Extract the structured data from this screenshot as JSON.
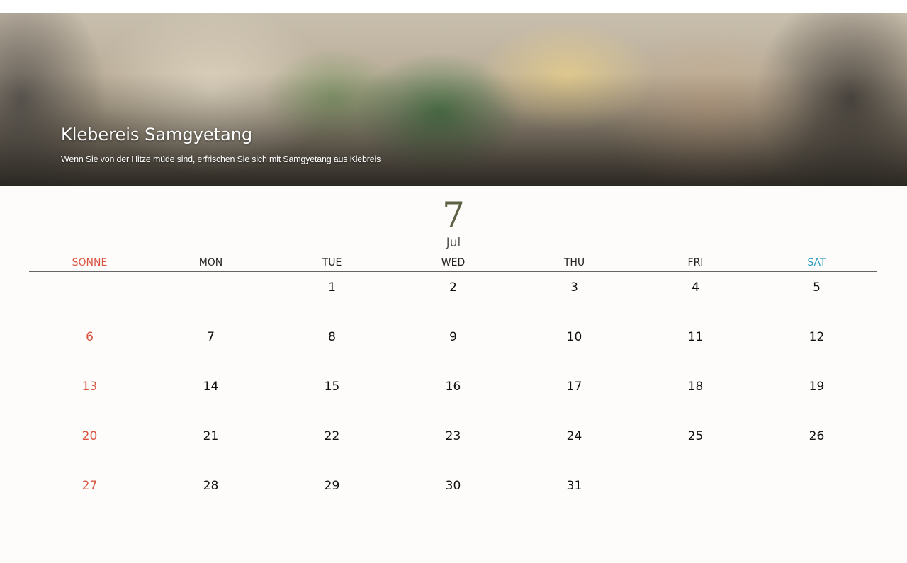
{
  "hero": {
    "title": "Klebereis Samgyetang",
    "subtitle": "Wenn Sie von der Hitze müde sind, erfrischen Sie sich mit Samgyetang aus Klebreis"
  },
  "month": {
    "number": "7",
    "name": "Jul"
  },
  "weekdays": [
    "SONNE",
    "MON",
    "TUE",
    "WED",
    "THU",
    "FRI",
    "SAT"
  ],
  "weeks": [
    [
      "",
      "",
      "1",
      "2",
      "3",
      "4",
      "5"
    ],
    [
      "6",
      "7",
      "8",
      "9",
      "10",
      "11",
      "12"
    ],
    [
      "13",
      "14",
      "15",
      "16",
      "17",
      "18",
      "19"
    ],
    [
      "20",
      "21",
      "22",
      "23",
      "24",
      "25",
      "26"
    ],
    [
      "27",
      "28",
      "29",
      "30",
      "31",
      "",
      ""
    ]
  ],
  "colors": {
    "sunday": "#d9533f",
    "saturday": "#2a9bbf",
    "month_number": "#5b6142"
  }
}
